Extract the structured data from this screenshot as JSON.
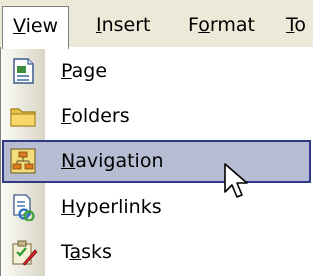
{
  "menubar": {
    "items": [
      {
        "pre": "",
        "key": "V",
        "post": "iew"
      },
      {
        "pre": "",
        "key": "I",
        "post": "nsert"
      },
      {
        "pre": "F",
        "key": "o",
        "post": "rmat"
      },
      {
        "pre": "",
        "key": "T",
        "post": "o"
      }
    ]
  },
  "dropdown": {
    "items": [
      {
        "pre": "",
        "key": "P",
        "post": "age",
        "icon": "page-icon"
      },
      {
        "pre": "",
        "key": "F",
        "post": "olders",
        "icon": "folder-icon"
      },
      {
        "pre": "",
        "key": "N",
        "post": "avigation",
        "icon": "navigation-icon"
      },
      {
        "pre": "",
        "key": "H",
        "post": "yperlinks",
        "icon": "hyperlinks-icon"
      },
      {
        "pre": "T",
        "key": "a",
        "post": "sks",
        "icon": "tasks-icon"
      }
    ],
    "selected_index": 2
  },
  "colors": {
    "menubar_bg": "#ece9d8",
    "highlight_bg": "#b6bdd2",
    "highlight_border": "#2d3b87"
  }
}
